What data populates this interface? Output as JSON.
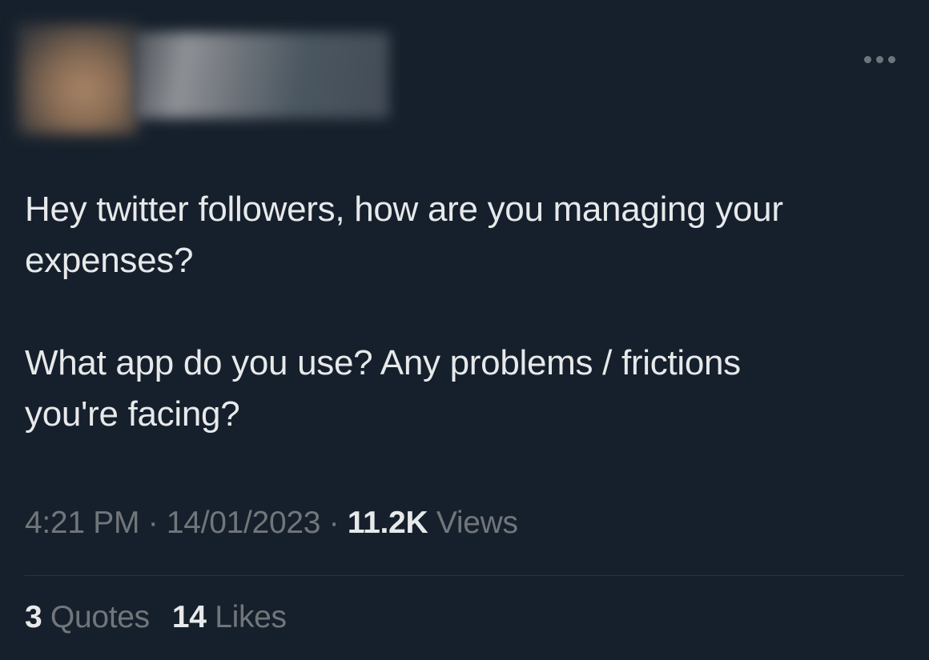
{
  "author": {
    "avatar_icon": "blurred-avatar-image",
    "name_icon": "blurred-name-image"
  },
  "menu": {
    "icon": "more-horizontal-icon"
  },
  "tweet": {
    "paragraph_1": "Hey twitter followers, how are you managing your\nexpenses?",
    "paragraph_2": "What app do you use? Any problems / frictions\nyou're facing?"
  },
  "meta": {
    "time": "4:21 PM",
    "separator_1": " · ",
    "date": "14/01/2023",
    "separator_2": " · ",
    "views_count": "11.2K",
    "views_label": " Views"
  },
  "stats": {
    "quotes_count": "3",
    "quotes_label": " Quotes",
    "likes_count": "14",
    "likes_label": " Likes"
  },
  "colors": {
    "background": "#16202c",
    "text_primary": "#e7e9ea",
    "text_secondary": "#71767b",
    "divider": "#2f3336"
  }
}
